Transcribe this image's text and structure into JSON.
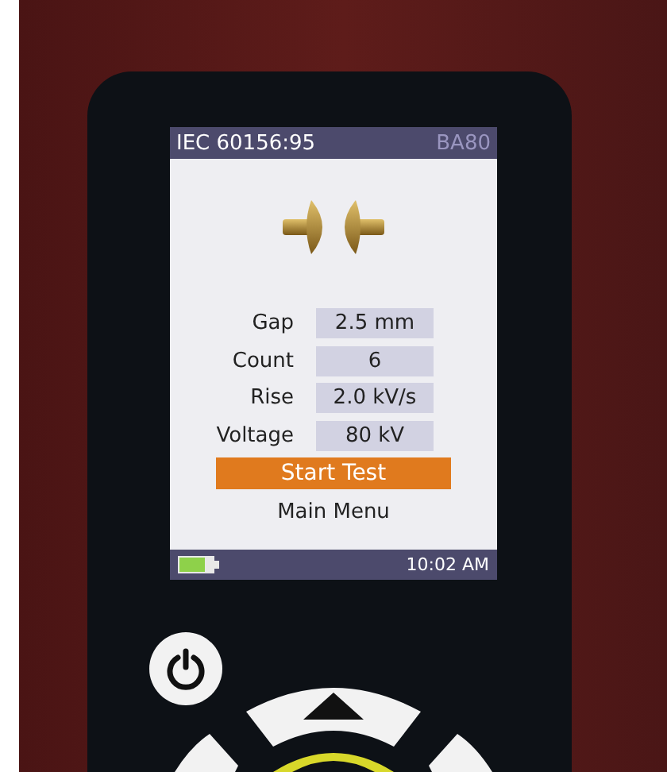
{
  "screen": {
    "header": {
      "title": "IEC 60156:95",
      "model": "BA80"
    },
    "fields": [
      {
        "label": "Gap",
        "value": "2.5 mm"
      },
      {
        "label": "Count",
        "value": "6"
      },
      {
        "label": "Rise",
        "value": "2.0 kV/s"
      },
      {
        "label": "Voltage",
        "value": "80 kV"
      }
    ],
    "menu": [
      {
        "label": "Start Test",
        "selected": true
      },
      {
        "label": "Main Menu",
        "selected": false
      }
    ],
    "status_bar": {
      "time": "10:02 AM"
    }
  }
}
